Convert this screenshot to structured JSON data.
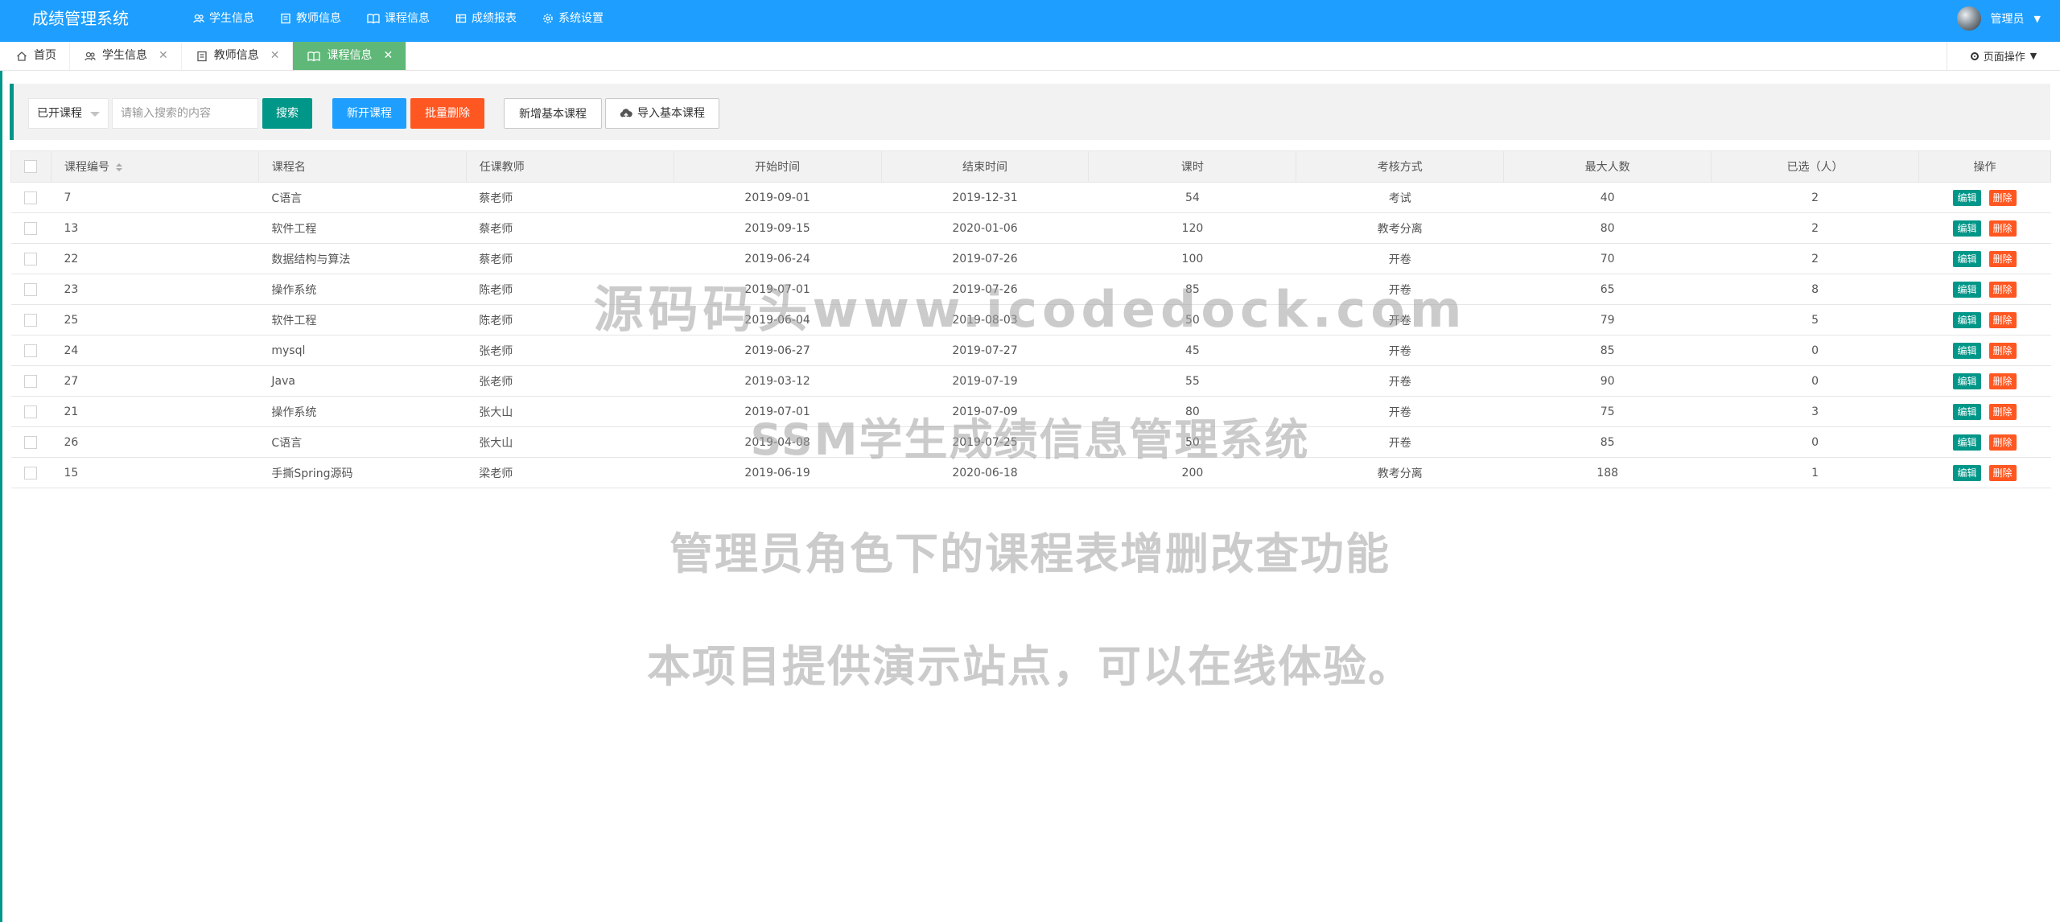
{
  "app": {
    "title": "成绩管理系统"
  },
  "topnav": [
    {
      "label": "学生信息",
      "icon": "users-icon"
    },
    {
      "label": "教师信息",
      "icon": "id-card-icon"
    },
    {
      "label": "课程信息",
      "icon": "book-icon",
      "active": true
    },
    {
      "label": "成绩报表",
      "icon": "table-icon"
    },
    {
      "label": "系统设置",
      "icon": "gear-icon"
    }
  ],
  "user": {
    "name": "管理员"
  },
  "tabs": [
    {
      "label": "首页",
      "icon": "home-icon"
    },
    {
      "label": "学生信息",
      "icon": "users-icon"
    },
    {
      "label": "教师信息",
      "icon": "id-card-icon"
    },
    {
      "label": "课程信息",
      "icon": "book-icon",
      "active": true
    }
  ],
  "page_ops": {
    "label": "页面操作"
  },
  "toolbar": {
    "filter_value": "已开课程",
    "search_placeholder": "请输入搜索的内容",
    "search_label": "搜索",
    "new_course_label": "新开课程",
    "batch_delete_label": "批量删除",
    "add_base_label": "新增基本课程",
    "import_base_label": "导入基本课程"
  },
  "table": {
    "headers": {
      "course_id": "课程编号",
      "course_name": "课程名",
      "teacher": "任课教师",
      "start": "开始时间",
      "end": "结束时间",
      "hours": "课时",
      "exam": "考核方式",
      "max": "最大人数",
      "selected": "已选（人）",
      "ops": "操作"
    },
    "edit_label": "编辑",
    "delete_label": "删除",
    "rows": [
      [
        "7",
        "C语言",
        "蔡老师",
        "2019-09-01",
        "2019-12-31",
        "54",
        "考试",
        "40",
        "2"
      ],
      [
        "13",
        "软件工程",
        "蔡老师",
        "2019-09-15",
        "2020-01-06",
        "120",
        "教考分离",
        "80",
        "2"
      ],
      [
        "22",
        "数据结构与算法",
        "蔡老师",
        "2019-06-24",
        "2019-07-26",
        "100",
        "开卷",
        "70",
        "2"
      ],
      [
        "23",
        "操作系统",
        "陈老师",
        "2019-07-01",
        "2019-07-26",
        "85",
        "开卷",
        "65",
        "8"
      ],
      [
        "25",
        "软件工程",
        "陈老师",
        "2019-06-04",
        "2019-08-03",
        "50",
        "开卷",
        "79",
        "5"
      ],
      [
        "24",
        "mysql",
        "张老师",
        "2019-06-27",
        "2019-07-27",
        "45",
        "开卷",
        "85",
        "0"
      ],
      [
        "27",
        "Java",
        "张老师",
        "2019-03-12",
        "2019-07-19",
        "55",
        "开卷",
        "90",
        "0"
      ],
      [
        "21",
        "操作系统",
        "张大山",
        "2019-07-01",
        "2019-07-09",
        "80",
        "开卷",
        "75",
        "3"
      ],
      [
        "26",
        "C语言",
        "张大山",
        "2019-04-08",
        "2019-07-25",
        "50",
        "开卷",
        "85",
        "0"
      ],
      [
        "15",
        "手撕Spring源码",
        "梁老师",
        "2019-06-19",
        "2020-06-18",
        "200",
        "教考分离",
        "188",
        "1"
      ]
    ]
  },
  "watermarks": [
    "源码码头www.icodedock.com",
    "SSM学生成绩信息管理系统",
    "管理员角色下的课程表增删改查功能",
    "本项目提供演示站点，可以在线体验。"
  ],
  "colors": {
    "header_blue": "#1e9fff",
    "active_green": "#5fb878",
    "primary_teal": "#009688",
    "danger_orange": "#ff5722"
  }
}
